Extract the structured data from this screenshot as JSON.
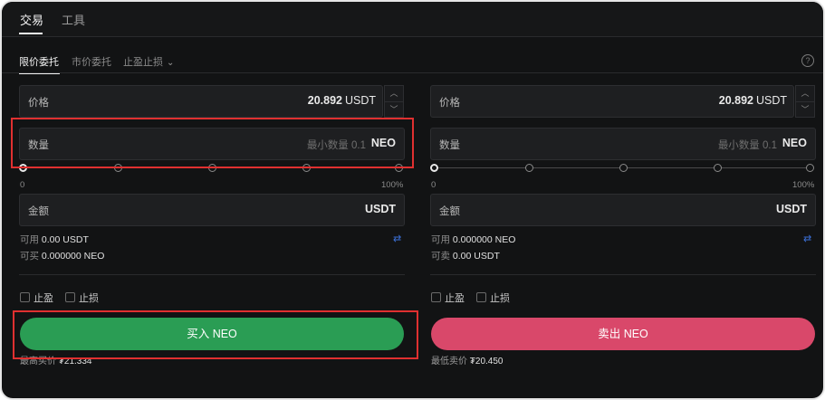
{
  "top_tabs": {
    "trade": "交易",
    "tools": "工具"
  },
  "order_tabs": {
    "limit": "限价委托",
    "market": "市价委托",
    "tpsl": "止盈止损"
  },
  "buy": {
    "price_label": "价格",
    "price_value": "20.892",
    "price_unit": "USDT",
    "qty_label": "数量",
    "qty_placeholder": "最小数量 0.1",
    "qty_unit": "NEO",
    "slider_min": "0",
    "slider_max": "100%",
    "amount_label": "金额",
    "amount_unit": "USDT",
    "available_label": "可用",
    "available_value": "0.00 USDT",
    "can_buy_label": "可买",
    "can_buy_value": "0.000000 NEO",
    "take_profit": "止盈",
    "stop_loss": "止损",
    "button": "买入 NEO",
    "note_label": "最高买价",
    "note_value": "₮21.334"
  },
  "sell": {
    "price_label": "价格",
    "price_value": "20.892",
    "price_unit": "USDT",
    "qty_label": "数量",
    "qty_placeholder": "最小数量 0.1",
    "qty_unit": "NEO",
    "slider_min": "0",
    "slider_max": "100%",
    "amount_label": "金额",
    "amount_unit": "USDT",
    "available_label": "可用",
    "available_value": "0.000000 NEO",
    "can_sell_label": "可卖",
    "can_sell_value": "0.00 USDT",
    "take_profit": "止盈",
    "stop_loss": "止损",
    "button": "卖出 NEO",
    "note_label": "最低卖价",
    "note_value": "₮20.450"
  },
  "colors": {
    "buy": "#2a9d54",
    "sell": "#d9486a",
    "highlight": "#e03030",
    "swap": "#3b6fd6"
  }
}
